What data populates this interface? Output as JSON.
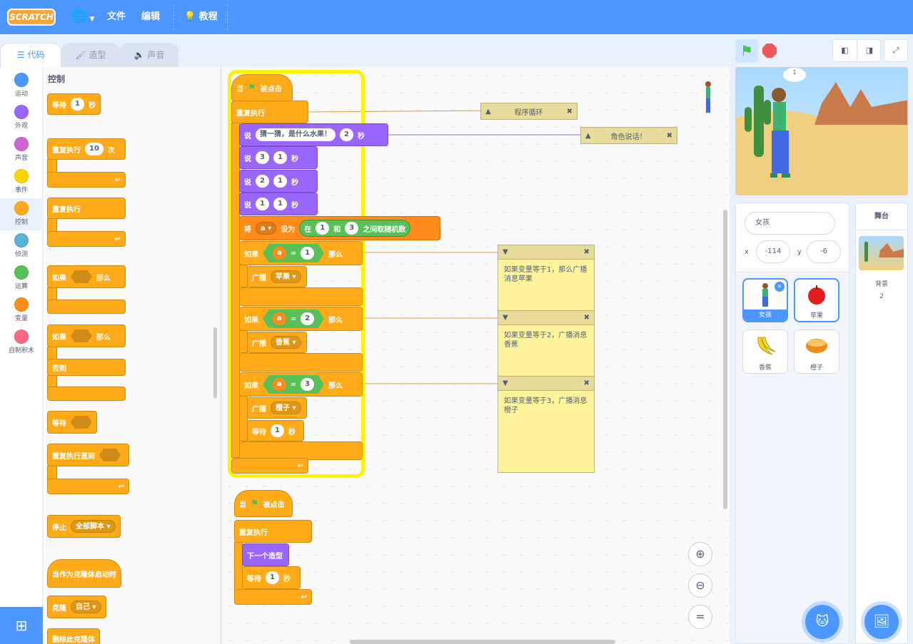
{
  "menu": {
    "logo": "SCRATCH",
    "file": "文件",
    "edit": "编辑",
    "tutorials": "教程"
  },
  "tabs": {
    "code": "代码",
    "costumes": "造型",
    "sounds": "声音"
  },
  "categories": [
    {
      "label": "运动",
      "color": "#4c97ff"
    },
    {
      "label": "外观",
      "color": "#9966ff"
    },
    {
      "label": "声音",
      "color": "#cf63cf"
    },
    {
      "label": "事件",
      "color": "#ffd500"
    },
    {
      "label": "控制",
      "color": "#ffab19"
    },
    {
      "label": "侦测",
      "color": "#5cb1d6"
    },
    {
      "label": "运算",
      "color": "#59c059"
    },
    {
      "label": "变量",
      "color": "#ff8c1a"
    },
    {
      "label": "自制积木",
      "color": "#ff6680"
    }
  ],
  "palette": {
    "title": "控制",
    "wait": "等待",
    "wait_val": "1",
    "sec": "秒",
    "repeat": "重复执行",
    "repeat_val": "10",
    "times": "次",
    "forever": "重复执行",
    "if": "如果",
    "then": "那么",
    "else": "否则",
    "wait_until": "等待",
    "repeat_until": "重复执行直到",
    "stop": "停止",
    "stop_opt": "全部脚本",
    "clone_start": "当作为克隆体启动时",
    "clone": "克隆",
    "clone_opt": "自己",
    "delete_clone": "删除此克隆体"
  },
  "script1": {
    "when": "当",
    "clicked": "被点击",
    "forever": "重复执行",
    "say": "说",
    "say_text": "猜一猜，是什么水果！",
    "say_secs": "2",
    "sec": "秒",
    "c3": "3",
    "c2": "2",
    "c1": "1",
    "one": "1",
    "set": "将",
    "var": "a",
    "set_to": "设为",
    "rand_in": "在",
    "and": "和",
    "rand_lo": "1",
    "rand_hi": "3",
    "rand_tail": "之间取随机数",
    "if": "如果",
    "then": "那么",
    "eq": "=",
    "v1": "1",
    "v2": "2",
    "v3": "3",
    "broadcast": "广播",
    "msg1": "苹果",
    "msg2": "香蕉",
    "msg3": "橙子",
    "wait": "等待",
    "wait_val": "1"
  },
  "script2": {
    "when": "当",
    "clicked": "被点击",
    "forever": "重复执行",
    "next_costume": "下一个造型",
    "wait": "等待",
    "wait_val": "1",
    "sec": "秒"
  },
  "notes": {
    "loop": "程序循环",
    "speak": "角色说话！",
    "n1": "如果变量等于1，那么广播消息苹果",
    "n2": "如果变量等于2，广播消息香蕉",
    "n3": "如果变量等于3，广播消息橙子"
  },
  "stage": {
    "bubble": "1"
  },
  "sprite_info": {
    "name": "女孩",
    "x_label": "x",
    "x": "-114",
    "y_label": "y",
    "y": "-6"
  },
  "sprites": [
    {
      "name": "女孩"
    },
    {
      "name": "苹果"
    },
    {
      "name": "香蕉"
    },
    {
      "name": "橙子"
    }
  ],
  "stage_panel": {
    "title": "舞台",
    "backdrop_label": "背景",
    "backdrop_count": "2"
  }
}
